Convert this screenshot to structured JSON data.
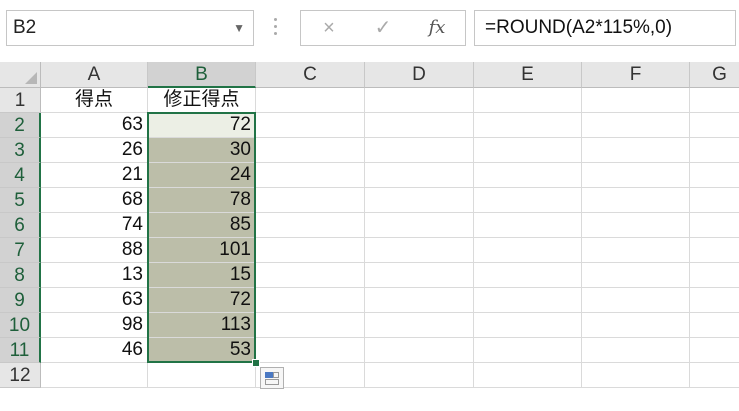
{
  "formula_bar": {
    "name_box": "B2",
    "cancel_icon": "×",
    "enter_icon": "✓",
    "fx_label": "fx",
    "formula": "=ROUND(A2*115%,0)"
  },
  "columns": [
    "A",
    "B",
    "C",
    "D",
    "E",
    "F",
    "G"
  ],
  "rows": [
    "1",
    "2",
    "3",
    "4",
    "5",
    "6",
    "7",
    "8",
    "9",
    "10",
    "11",
    "12"
  ],
  "headers": {
    "A": "得点",
    "B": "修正得点"
  },
  "data": [
    [
      "63",
      "72"
    ],
    [
      "26",
      "30"
    ],
    [
      "21",
      "24"
    ],
    [
      "68",
      "78"
    ],
    [
      "74",
      "85"
    ],
    [
      "88",
      "101"
    ],
    [
      "13",
      "15"
    ],
    [
      "63",
      "72"
    ],
    [
      "98",
      "113"
    ],
    [
      "46",
      "53"
    ]
  ],
  "colors": {
    "accent": "#217346",
    "selection_fill": "#bcbea9",
    "active_cell_fill": "#ecefe5"
  }
}
